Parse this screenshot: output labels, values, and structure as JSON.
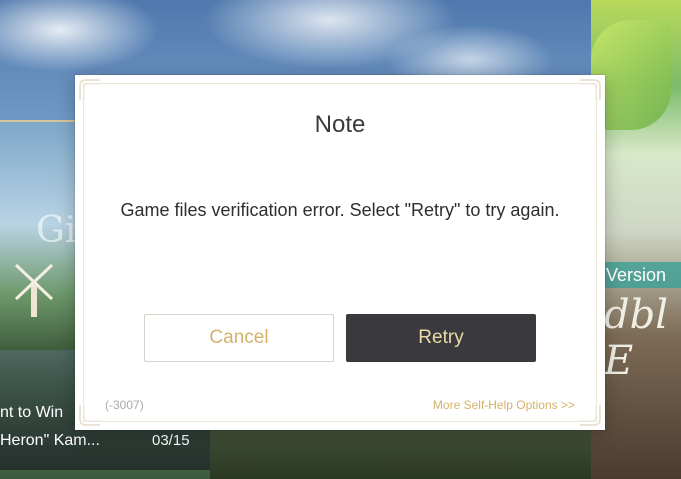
{
  "background": {
    "left_panel_title": "Gi",
    "news_items": [
      {
        "text": "nt to Win",
        "date": ""
      },
      {
        "text": " Heron\" Kam...",
        "date": "03/15"
      }
    ],
    "version_banner": "Version",
    "banner_letters": "dbl\nE"
  },
  "dialog": {
    "title": "Note",
    "message": "Game files verification error. Select \"Retry\" to try again.",
    "cancel_label": "Cancel",
    "retry_label": "Retry",
    "error_code": "(-3007)",
    "help_link": "More Self-Help Options >>"
  },
  "colors": {
    "accent_gold": "#d3b26a",
    "retry_bg": "#3a3a3e",
    "retry_text": "#ecd9a7",
    "dialog_bg": "#ffffff"
  }
}
